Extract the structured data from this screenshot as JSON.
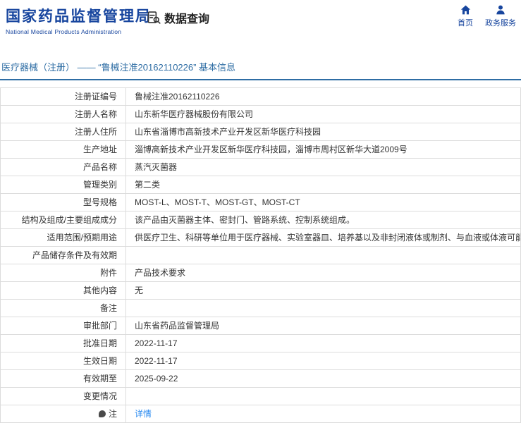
{
  "colors": {
    "brand_blue": "#17459e",
    "title_blue": "#2e6da4",
    "link_blue": "#2d8cf0",
    "border_gray": "#dcdcdc"
  },
  "header": {
    "logo": {
      "title_cn": "国家药品监督管理局",
      "title_en": "National Medical Products Administration"
    },
    "section_title": "数据查询",
    "nav": [
      {
        "label": "首页",
        "icon": "home-icon"
      },
      {
        "label": "政务服务",
        "icon": "person-icon"
      }
    ]
  },
  "page": {
    "title": "医疗器械（注册） ——  “鲁械注准20162110226”  基本信息"
  },
  "table": {
    "rows": [
      {
        "label": "注册证编号",
        "value": "鲁械注准20162110226"
      },
      {
        "label": "注册人名称",
        "value": "山东新华医疗器械股份有限公司"
      },
      {
        "label": "注册人住所",
        "value": "山东省淄博市高新技术产业开发区新华医疗科技园"
      },
      {
        "label": "生产地址",
        "value": "淄博高新技术产业开发区新华医疗科技园，淄博市周村区新华大道2009号"
      },
      {
        "label": "产品名称",
        "value": "蒸汽灭菌器"
      },
      {
        "label": "管理类别",
        "value": "第二类"
      },
      {
        "label": "型号规格",
        "value": "MOST-L、MOST-T、MOST-GT、MOST-CT"
      },
      {
        "label": "结构及组成/主要组成成分",
        "value": "该产品由灭菌器主体、密封门、管路系统、控制系统组成。"
      },
      {
        "label": "适用范围/预期用途",
        "value": "供医疗卫生、科研等单位用于医疗器械、实验室器皿、培养基以及非封闭液体或制剂、与血液或体液可能接触的材料的灭菌。"
      },
      {
        "label": "产品储存条件及有效期",
        "value": ""
      },
      {
        "label": "附件",
        "value": "产品技术要求"
      },
      {
        "label": "其他内容",
        "value": "无"
      },
      {
        "label": "备注",
        "value": ""
      },
      {
        "label": "审批部门",
        "value": "山东省药品监督管理局"
      },
      {
        "label": "批准日期",
        "value": "2022-11-17"
      },
      {
        "label": "生效日期",
        "value": "2022-11-17"
      },
      {
        "label": "有效期至",
        "value": "2025-09-22"
      },
      {
        "label": "变更情况",
        "value": ""
      },
      {
        "label": "注",
        "value": "详情",
        "is_link": true,
        "has_icon": true
      }
    ]
  }
}
